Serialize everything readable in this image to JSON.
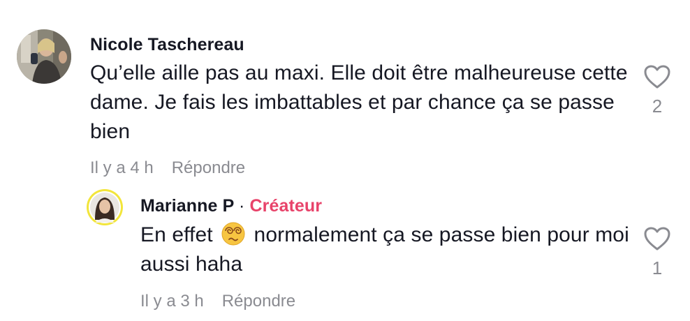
{
  "comment": {
    "username": "Nicole Taschereau",
    "text": "Qu’elle aille pas au maxi. Elle doit être malheureuse cette dame. Je fais les imbattables et par chance ça se passe bien",
    "time": "Il y a 4 h",
    "reply_label": "Répondre",
    "likes": "2",
    "like_icon": "heart-outline-icon"
  },
  "reply": {
    "username": "Marianne P",
    "separator": "·",
    "badge": "Créateur",
    "text_before_emoji": "En effet",
    "emoji_name": "dizzy-face-emoji",
    "text_after_emoji": "normalement ça se passe bien pour moi aussi haha",
    "time": "Il y a 3 h",
    "reply_label": "Répondre",
    "likes": "1",
    "like_icon": "heart-outline-icon"
  },
  "colors": {
    "text": "#161823",
    "muted": "#8a8b91",
    "creator_badge": "#e8436a",
    "avatar_ring": "#f2e53b"
  }
}
